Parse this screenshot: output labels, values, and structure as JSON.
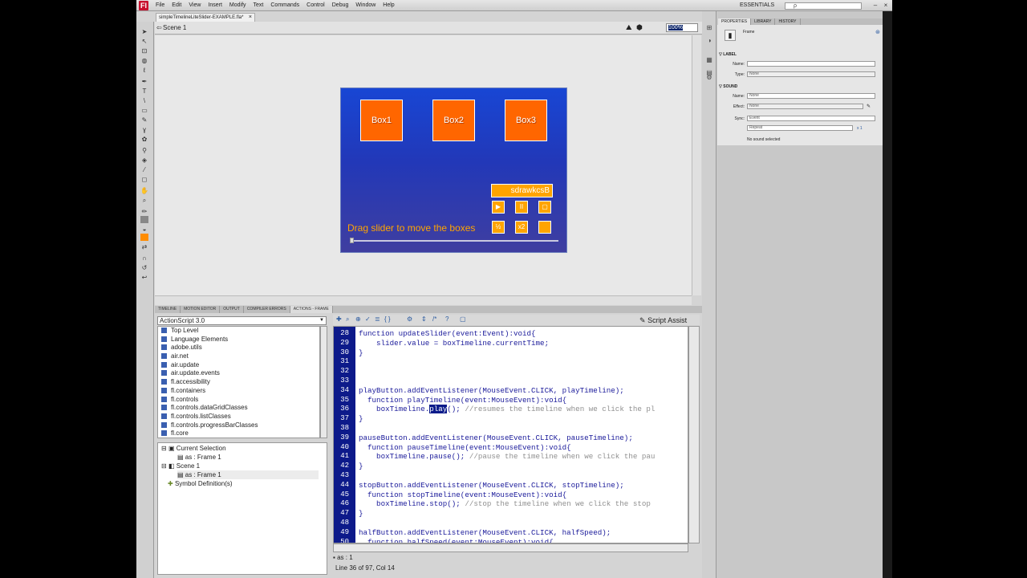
{
  "menubar": {
    "logo": "Fl",
    "items": [
      "File",
      "Edit",
      "View",
      "Insert",
      "Modify",
      "Text",
      "Commands",
      "Control",
      "Debug",
      "Window",
      "Help"
    ],
    "workspace": "ESSENTIALS",
    "search_placeholder": "ρ"
  },
  "document": {
    "tab_label": "simpleTimelineLiteSlider-EXAMPLE.fla*",
    "tab_close": "×"
  },
  "stage_bar": {
    "scene": "Scene 1",
    "zoom": "100%"
  },
  "stage": {
    "boxes": [
      "Box1",
      "Box2",
      "Box3"
    ],
    "credit_text": "sdrawkcsB",
    "controls_row1": [
      "▶",
      "II",
      "▢"
    ],
    "controls_row2": [
      "½",
      "x2",
      ""
    ],
    "drag_text": "Drag slider to move the boxes",
    "slider_value": 0
  },
  "panel_tabs": [
    "TIMELINE",
    "MOTION EDITOR",
    "OUTPUT",
    "COMPILER ERRORS",
    "ACTIONS - FRAME"
  ],
  "actions": {
    "version": "ActionScript 3.0",
    "toolbox": [
      "Top Level",
      "Language Elements",
      "adobe.utils",
      "air.net",
      "air.update",
      "air.update.events",
      "fl.accessibility",
      "fl.containers",
      "fl.controls",
      "fl.controls.dataGridClasses",
      "fl.controls.listClasses",
      "fl.controls.progressBarClasses",
      "fl.core"
    ],
    "navigator": [
      {
        "label": "Current Selection",
        "indent": 0
      },
      {
        "label": "as : Frame 1",
        "indent": 1
      },
      {
        "label": "Scene 1",
        "indent": 0
      },
      {
        "label": "as : Frame 1",
        "indent": 1
      },
      {
        "label": "Symbol Definition(s)",
        "indent": 0
      }
    ],
    "script_assist": "Script Assist",
    "code_lines": [
      {
        "n": "28",
        "code": "function updateSlider(event:Event):void{",
        "comment": ""
      },
      {
        "n": "29",
        "code": "    slider.value = boxTimeline.currentTime;",
        "comment": ""
      },
      {
        "n": "30",
        "code": "}",
        "comment": ""
      },
      {
        "n": "31",
        "code": "",
        "comment": ""
      },
      {
        "n": "32",
        "code": "",
        "comment": ""
      },
      {
        "n": "33",
        "code": "",
        "comment": ""
      },
      {
        "n": "34",
        "code": "playButton.addEventListener(MouseEvent.CLICK, playTimeline);",
        "comment": ""
      },
      {
        "n": "35",
        "code": "  function playTimeline(event:MouseEvent):void{",
        "comment": ""
      },
      {
        "n": "36",
        "code": "    boxTimeline.",
        "hl": "play",
        "rest": "(); ",
        "comment": "//resumes the timeline when we click the pl"
      },
      {
        "n": "37",
        "code": "}",
        "comment": ""
      },
      {
        "n": "38",
        "code": "",
        "comment": ""
      },
      {
        "n": "39",
        "code": "pauseButton.addEventListener(MouseEvent.CLICK, pauseTimeline);",
        "comment": ""
      },
      {
        "n": "40",
        "code": "  function pauseTimeline(event:MouseEvent):void{",
        "comment": ""
      },
      {
        "n": "41",
        "code": "    boxTimeline.pause(); ",
        "comment": "//pause the timeline when we click the pau"
      },
      {
        "n": "42",
        "code": "}",
        "comment": ""
      },
      {
        "n": "43",
        "code": "",
        "comment": ""
      },
      {
        "n": "44",
        "code": "stopButton.addEventListener(MouseEvent.CLICK, stopTimeline);",
        "comment": ""
      },
      {
        "n": "45",
        "code": "  function stopTimeline(event:MouseEvent):void{",
        "comment": ""
      },
      {
        "n": "46",
        "code": "    boxTimeline.stop(); ",
        "comment": "//stop the timeline when we click the stop"
      },
      {
        "n": "47",
        "code": "}",
        "comment": ""
      },
      {
        "n": "48",
        "code": "",
        "comment": ""
      },
      {
        "n": "49",
        "code": "halfButton.addEventListener(MouseEvent.CLICK, halfSpeed);",
        "comment": ""
      },
      {
        "n": "50",
        "code": "  function halfSpeed(event:MouseEvent):void{",
        "comment": ""
      }
    ],
    "script_tab": "as : 1",
    "status": "Line 36 of 97, Col 14"
  },
  "properties": {
    "tabs": [
      "PROPERTIES",
      "LIBRARY",
      "HISTORY"
    ],
    "object": "Frame",
    "label_section": "LABEL",
    "name_label": "Name:",
    "type_label": "Type:",
    "type_value": "None",
    "sound_section": "SOUND",
    "sound_name_label": "Name:",
    "sound_name_value": "None",
    "effect_label": "Effect:",
    "effect_value": "None",
    "sync_label": "Sync:",
    "sync_value": "Event",
    "repeat_value": "Repeat",
    "repeat_count": "x 1",
    "no_sound": "No sound selected"
  },
  "colors": {
    "stage_blue": "#1846d4",
    "box_orange": "#ff6600",
    "control_orange": "#ffa400",
    "gutter": "#0d1a8a"
  }
}
